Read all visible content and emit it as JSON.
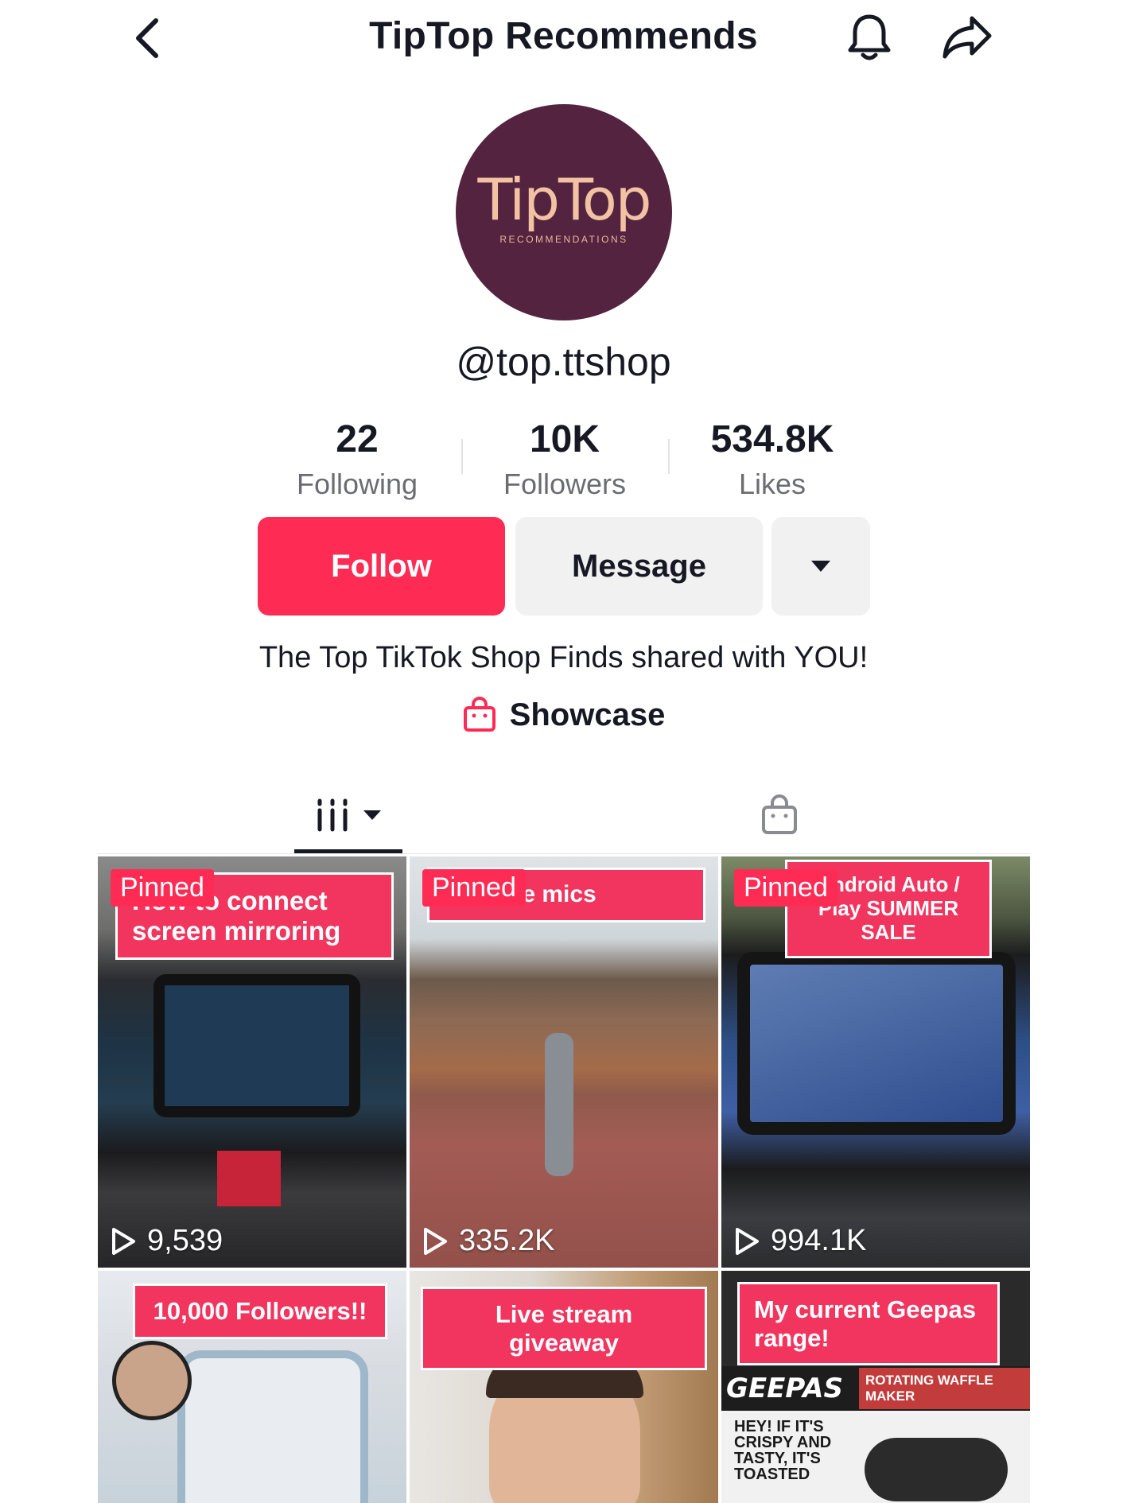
{
  "header": {
    "title": "TipTop Recommends"
  },
  "avatar": {
    "logo_text": "TipTop",
    "logo_subtext": "RECOMMENDATIONS"
  },
  "profile": {
    "handle": "@top.ttshop",
    "bio": "The Top TikTok Shop Finds shared with YOU!"
  },
  "stats": [
    {
      "value": "22",
      "label": "Following"
    },
    {
      "value": "10K",
      "label": "Followers"
    },
    {
      "value": "534.8K",
      "label": "Likes"
    }
  ],
  "actions": {
    "follow_label": "Follow",
    "message_label": "Message"
  },
  "showcase": {
    "label": "Showcase"
  },
  "videos": [
    {
      "pinned": "Pinned",
      "caption": "How to connect screen mirroring",
      "views": "9,539"
    },
    {
      "pinned": "Pinned",
      "caption": "s phone mics",
      "views": "335.2K"
    },
    {
      "pinned": "Pinned",
      "caption": "Android Auto / Play SUMMER SALE",
      "views": "994.1K"
    },
    {
      "caption": "10,000 Followers!!"
    },
    {
      "caption": "Live stream giveaway"
    },
    {
      "caption": "My current Geepas range!",
      "brand": "GEEPAS",
      "product": "ROTATING WAFFLE MAKER",
      "ad_text": "HEY! IF IT'S CRISPY AND TASTY, IT'S TOASTED"
    }
  ],
  "colors": {
    "accent": "#fe2c55",
    "avatar_bg": "#54233f",
    "logo": "#f2c3a2"
  },
  "icons": [
    "chevron-left-icon",
    "bell-icon",
    "share-icon",
    "caret-down-icon",
    "shopping-bag-icon",
    "grid-lines-icon",
    "play-icon"
  ]
}
